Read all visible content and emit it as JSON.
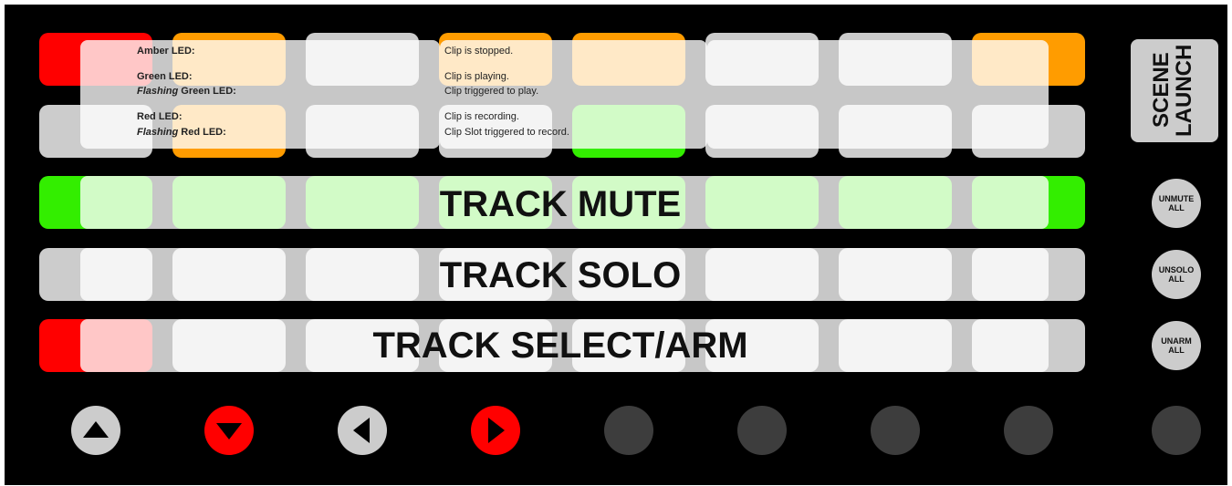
{
  "legend": [
    {
      "label_prefix": "",
      "label": "Amber LED:",
      "desc": "Clip is stopped."
    },
    {
      "label_prefix": "",
      "label": "Green LED:",
      "desc": "Clip is playing."
    },
    {
      "label_prefix": "Flashing",
      "label": " Green LED:",
      "desc": "Clip triggered to play."
    },
    {
      "label_prefix": "",
      "label": "Red LED:",
      "desc": "Clip is recording."
    },
    {
      "label_prefix": "Flashing",
      "label": " Red LED:",
      "desc": "Clip Slot triggered to record."
    }
  ],
  "rows": {
    "clip_row_1": [
      "red",
      "amber",
      "grey",
      "amber",
      "amber",
      "grey",
      "grey",
      "amber"
    ],
    "clip_row_2": [
      "grey",
      "amber",
      "grey",
      "grey",
      "green",
      "grey",
      "grey",
      "grey"
    ],
    "mute_row": [
      "green",
      "green",
      "green",
      "green",
      "green",
      "green",
      "green",
      "green"
    ],
    "solo_row": [
      "grey",
      "grey",
      "grey",
      "grey",
      "grey",
      "grey",
      "grey",
      "grey"
    ],
    "select_row": [
      "red",
      "grey",
      "grey",
      "grey",
      "grey",
      "grey",
      "grey",
      "grey"
    ]
  },
  "labels": {
    "track_mute": "TRACK MUTE",
    "track_solo": "TRACK SOLO",
    "track_select": "TRACK SELECT/ARM",
    "scene_launch": "SCENE LAUNCH"
  },
  "side_buttons": {
    "unmute_1": "UNMUTE",
    "unmute_2": "ALL",
    "unsolo_1": "UNSOLO",
    "unsolo_2": "ALL",
    "unarm_1": "UNARM",
    "unarm_2": "ALL"
  },
  "nav_buttons": [
    {
      "name": "up-arrow-button",
      "style": "white",
      "icon": "up"
    },
    {
      "name": "down-arrow-button",
      "style": "red",
      "icon": "down"
    },
    {
      "name": "left-arrow-button",
      "style": "white",
      "icon": "left"
    },
    {
      "name": "right-arrow-button",
      "style": "red",
      "icon": "right"
    },
    {
      "name": "bottom-button-5",
      "style": "dark",
      "icon": ""
    },
    {
      "name": "bottom-button-6",
      "style": "dark",
      "icon": ""
    },
    {
      "name": "bottom-button-7",
      "style": "dark",
      "icon": ""
    },
    {
      "name": "bottom-button-8",
      "style": "dark",
      "icon": ""
    },
    {
      "name": "bottom-button-9",
      "style": "dark",
      "icon": ""
    }
  ],
  "colors": {
    "red": "#ff0000",
    "amber": "#ff9c00",
    "green": "#33ee00",
    "grey": "#cccccc",
    "dark": "#3d3d3d",
    "panel": "#000000"
  }
}
